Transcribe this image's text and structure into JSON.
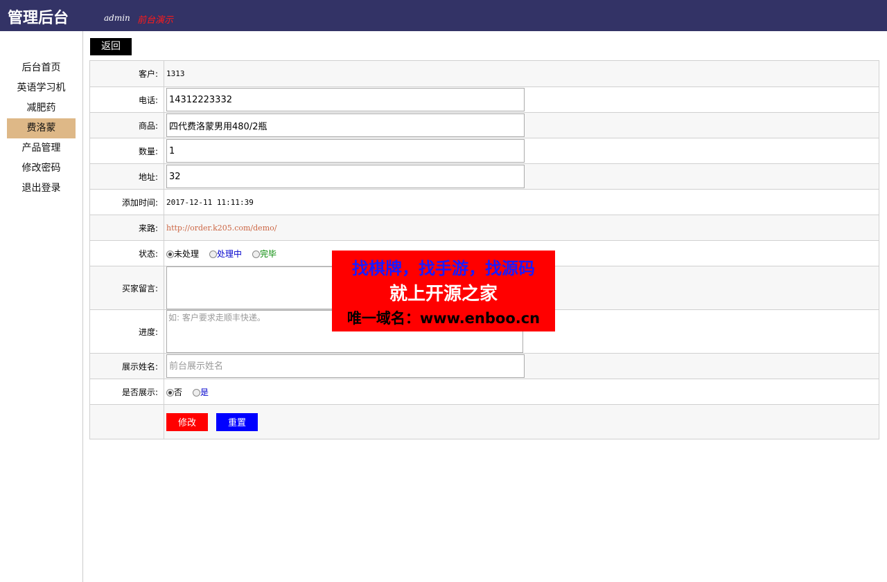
{
  "header": {
    "title": "管理后台",
    "user": "admin",
    "demo_link": "前台演示"
  },
  "sidebar": {
    "items": [
      {
        "label": "后台首页",
        "active": false
      },
      {
        "label": "英语学习机",
        "active": false
      },
      {
        "label": "减肥药",
        "active": false
      },
      {
        "label": "费洛蒙",
        "active": true
      },
      {
        "label": "产品管理",
        "active": false
      },
      {
        "label": "修改密码",
        "active": false
      },
      {
        "label": "退出登录",
        "active": false
      }
    ]
  },
  "back_button": "返回",
  "form": {
    "customer": {
      "label": "客户:",
      "value": "1313"
    },
    "phone": {
      "label": "电话:",
      "value": "14312223332"
    },
    "product": {
      "label": "商品:",
      "value": "四代费洛蒙男用480/2瓶"
    },
    "quantity": {
      "label": "数量:",
      "value": "1"
    },
    "address": {
      "label": "地址:",
      "value": "32"
    },
    "added_time": {
      "label": "添加时间:",
      "value": "2017-12-11 11:11:39"
    },
    "source": {
      "label": "来路:",
      "value": "http://order.k205.com/demo/"
    },
    "status": {
      "label": "状态:",
      "options": [
        {
          "label": "未处理",
          "color": "#000000",
          "checked": true
        },
        {
          "label": "处理中",
          "color": "#0000cc",
          "checked": false
        },
        {
          "label": "完毕",
          "color": "#008800",
          "checked": false
        }
      ]
    },
    "buyer_message": {
      "label": "买家留言:",
      "value": ""
    },
    "progress": {
      "label": "进度:",
      "placeholder": "如: 客户要求走顺丰快递。"
    },
    "display_name": {
      "label": "展示姓名:",
      "placeholder": "前台展示姓名"
    },
    "show": {
      "label": "是否展示:",
      "options": [
        {
          "label": "否",
          "color": "#000000",
          "checked": true
        },
        {
          "label": "是",
          "color": "#0000cc",
          "checked": false
        }
      ]
    },
    "submit_label": "修改",
    "reset_label": "重置"
  },
  "ad": {
    "line1": "找棋牌，找手游，找源码",
    "line2": "就上开源之家",
    "line3": "唯一域名：www.enboo.cn"
  },
  "colors": {
    "topbar": "#333366",
    "active_nav": "#deb887",
    "submit": "#ff0000",
    "reset": "#0000ff"
  }
}
